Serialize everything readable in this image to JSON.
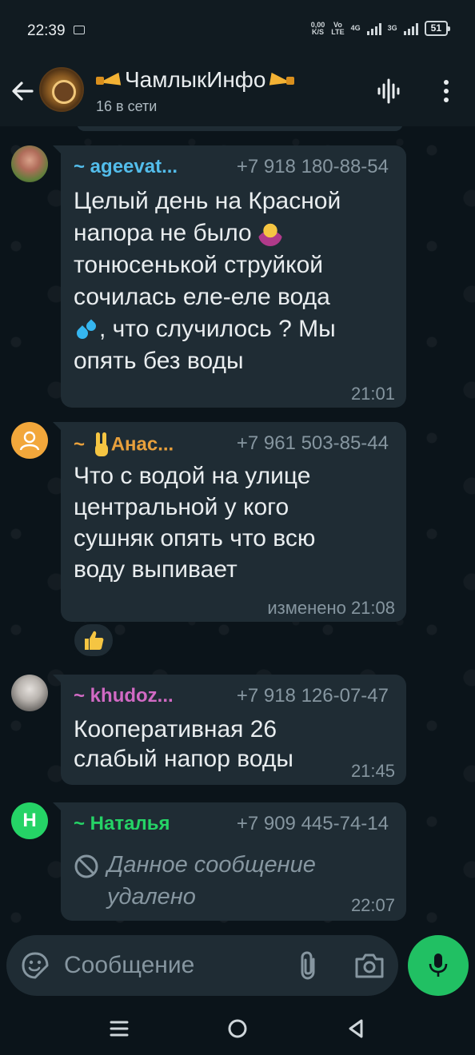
{
  "status_bar": {
    "time": "22:39",
    "net_speed_top": "0,00",
    "net_speed_bottom": "K/S",
    "volte_top": "Vo",
    "volte_bottom": "LTE",
    "net1": "4G",
    "net2": "3G",
    "battery": "51"
  },
  "header": {
    "title": "ЧамлыкИнфо",
    "subtitle": "16 в сети"
  },
  "messages": [
    {
      "sender": "~ ageevat...",
      "sender_color": "#53bdeb",
      "phone": "+7 918 180-88-54",
      "text_parts": [
        "Целый день на Красной\nнапора не было ",
        "\nтонюсенькой струйкой\nсочилась  еле-еле вода\n",
        ", что случилось ? Мы\nопять без воды"
      ],
      "emoji": [
        "person-shrugging",
        "sweat-droplets"
      ],
      "time": "21:01"
    },
    {
      "sender": "Анас...",
      "sender_prefix": "~ ",
      "sender_color": "#e8a03c",
      "phone": "+7 961 503-85-44",
      "emoji": [
        "victory-hand"
      ],
      "text": "Что с водой на улице\nцентральной у кого\nсушняк опять что всю\nводу выпивает",
      "time": "изменено 21:08",
      "reaction": "thumbs-up"
    },
    {
      "sender": "~ khudoz...",
      "sender_color": "#d16ac4",
      "phone": "+7 918 126-07-47",
      "text": "Кооперативная  26\nслабый напор воды",
      "time": "21:45"
    },
    {
      "sender": "~ Наталья",
      "avatar_letter": "Н",
      "sender_color": "#25d366",
      "phone": "+7 909 445-74-14",
      "deleted_text": "Данное сообщение\nудалено",
      "time": "22:07"
    }
  ],
  "input": {
    "placeholder": "Сообщение"
  },
  "colors": {
    "header_bg": "#111b21",
    "chat_bg": "#0b141a",
    "bubble_bg": "#1f2c34",
    "mic_button": "#21c063"
  }
}
